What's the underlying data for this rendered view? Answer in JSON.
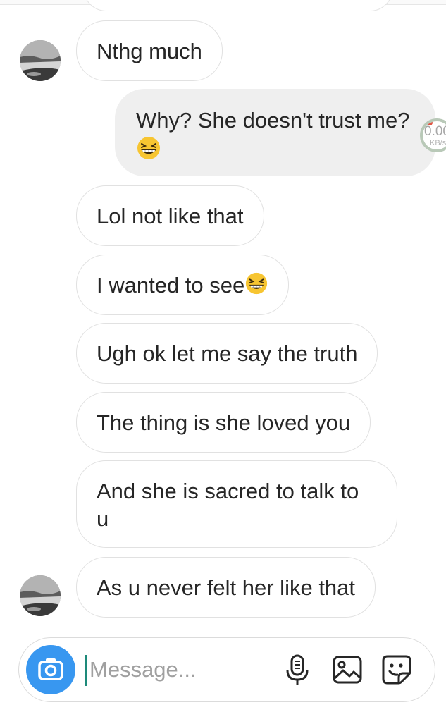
{
  "thread": {
    "messages": [
      {
        "side": "in",
        "text": "Nthg much",
        "avatar": true
      },
      {
        "side": "out",
        "text": "Why? She doesn't trust me?",
        "emoji": "grinning-squinting-face"
      },
      {
        "side": "in",
        "text": "Lol not like that"
      },
      {
        "side": "in",
        "text": "I wanted to see",
        "emoji": "grinning-squinting-face"
      },
      {
        "side": "in",
        "text": "Ugh ok let me say the truth"
      },
      {
        "side": "in",
        "text": "The thing is she loved you"
      },
      {
        "side": "in",
        "text": "And she is sacred to talk to u"
      },
      {
        "side": "in",
        "text": "As u never felt her like that",
        "avatar": true
      }
    ]
  },
  "overlay": {
    "speed_value": "0.00",
    "speed_unit": "KB/s"
  },
  "composer": {
    "placeholder": "Message...",
    "value": "",
    "icons": [
      "camera-icon",
      "microphone-icon",
      "gallery-icon",
      "sticker-icon"
    ]
  },
  "colors": {
    "accent": "#3897f0",
    "incoming_bubble_border": "#e1e1e1",
    "outgoing_bubble_bg": "#efefef",
    "text": "#262626",
    "placeholder": "#a0a0a0",
    "caret": "#1e8a7a"
  }
}
